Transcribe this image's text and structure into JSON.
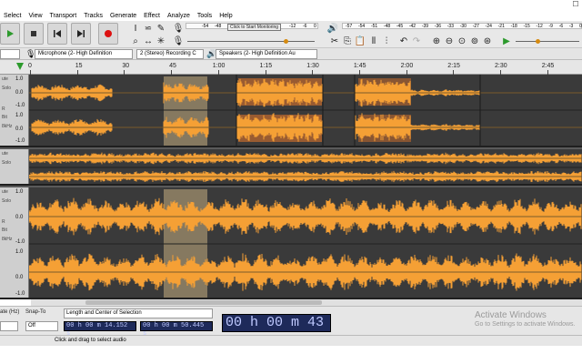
{
  "window": {
    "maximize_label": "☐"
  },
  "menu": [
    "Select",
    "View",
    "Transport",
    "Tracks",
    "Generate",
    "Effect",
    "Analyze",
    "Tools",
    "Help"
  ],
  "meters": {
    "record_prompt": "Click to Start Monitoring",
    "record_ticks": [
      "-54",
      "-48",
      "-12",
      "-6",
      "0"
    ],
    "play_ticks": [
      "-57",
      "-54",
      "-51",
      "-48",
      "-45",
      "-42",
      "-39",
      "-36",
      "-33",
      "-30",
      "-27",
      "-24",
      "-21",
      "-18",
      "-15",
      "-12",
      "-9",
      "-6",
      "-3",
      "0"
    ]
  },
  "devices": {
    "mic": "Microphone (2- High Definition",
    "channels": "2 (Stereo) Recording C",
    "speakers": "Speakers (2- High Definition Au"
  },
  "timeline": {
    "ticks": [
      "0",
      "15",
      "30",
      "45",
      "1:00",
      "1:15",
      "1:30",
      "1:45",
      "2:00",
      "2:15",
      "2:30",
      "2:45"
    ]
  },
  "tracks": [
    {
      "scale": [
        "1.0",
        "0.0",
        "-1.0",
        "1.0",
        "0.0",
        "-1.0"
      ],
      "labels": [
        "ute",
        "Solo",
        "R",
        "Bit",
        "8kHz"
      ]
    },
    {
      "scale": [],
      "labels": [
        "ute",
        "Solo"
      ]
    },
    {
      "scale": [
        "1.0",
        "0.0",
        "-1.0",
        "1.0",
        "0.0",
        "-1.0"
      ],
      "labels": [
        "ute",
        "Solo",
        "R",
        "Bit",
        "8kHz"
      ]
    }
  ],
  "selection_bar": {
    "rate_label": "ate (Hz)",
    "snap_label": "Snap-To",
    "snap_value": "Off",
    "mode": "Length and Center of Selection",
    "length": "00 h 00 m 14.152 s",
    "center": "00 h 00 m 50.445 s",
    "timer": "00 h 00 m 43 s"
  },
  "activate": {
    "title": "Activate Windows",
    "subtitle": "Go to Settings to activate Windows."
  },
  "status": "Click and drag to select audio",
  "colors": {
    "wave": "#f5a035",
    "wave_loud": "#e8772a",
    "selection": "#9a8a6a",
    "bg": "#3a3a3a"
  }
}
